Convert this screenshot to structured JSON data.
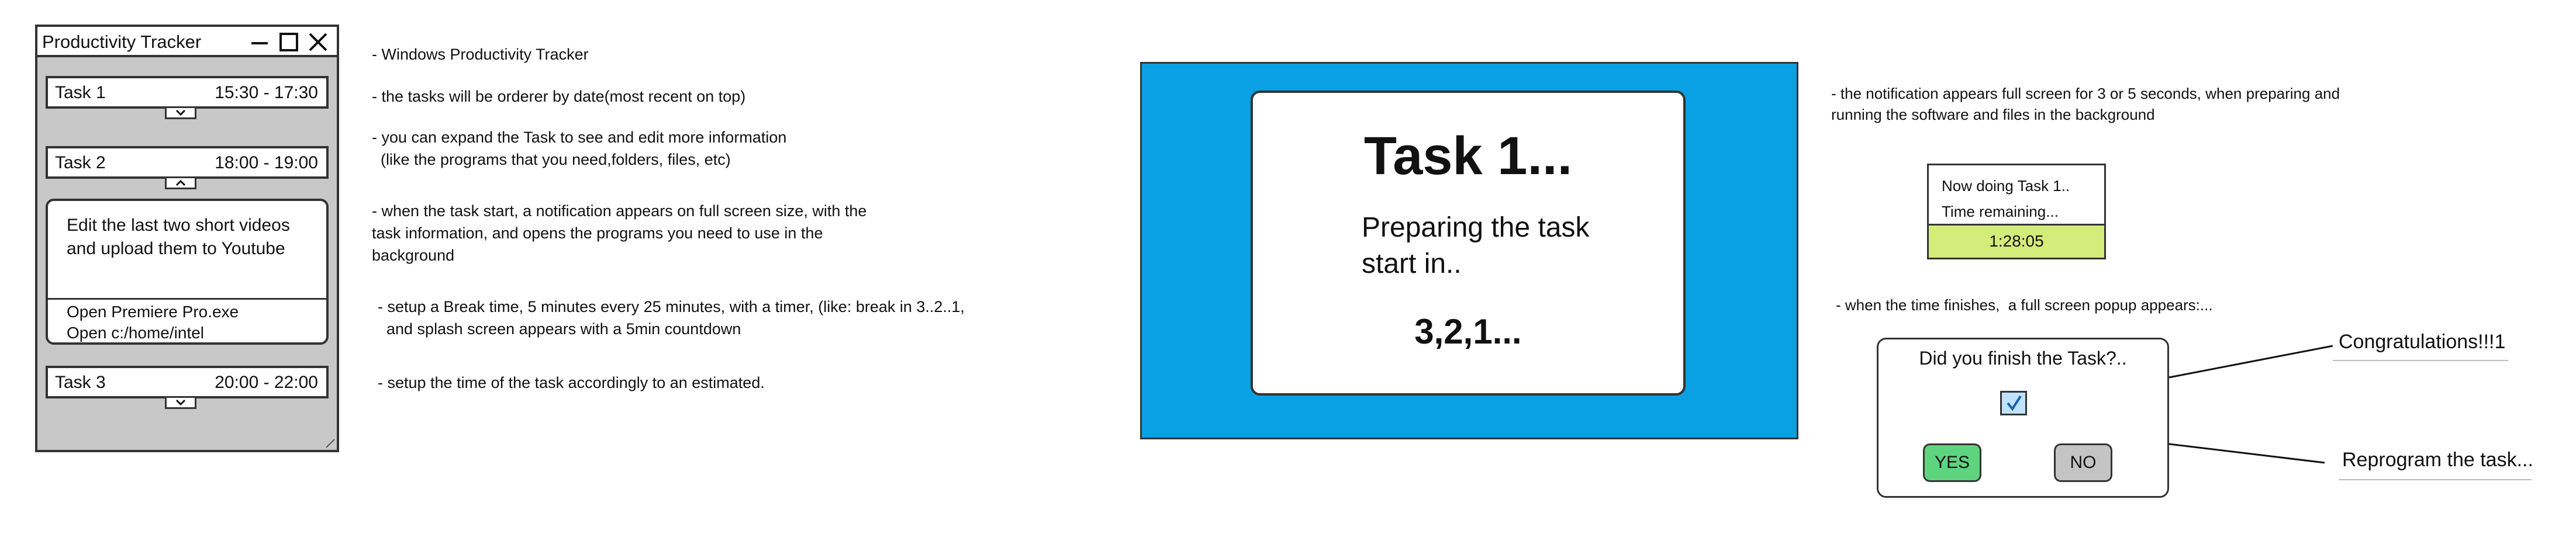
{
  "tracker": {
    "title": "Productivity Tracker",
    "tasks": [
      {
        "name": "Task 1",
        "time": "15:30 - 17:30",
        "expanded": false
      },
      {
        "name": "Task 2",
        "time": "18:00 - 19:00",
        "expanded": true,
        "description": "Edit the last two short videos and upload them to Youtube",
        "programs": [
          "Open Premiere Pro.exe",
          "Open c:/home/intel"
        ]
      },
      {
        "name": "Task 3",
        "time": "20:00 - 22:00",
        "expanded": false
      }
    ]
  },
  "notes": [
    "- Windows Productivity Tracker",
    "- the tasks will be orderer by date(most recent on top)",
    "- you can expand the Task to see and edit more information\n  (like the programs that you need,folders, files, etc)",
    "- when the task start, a notification appears on full screen size, with the\ntask information, and opens the programs you need to use in the\nbackground",
    "- setup a Break time, 5 minutes every 25 minutes, with a timer, (like: break in 3..2..1,\n  and splash screen appears with a 5min countdown",
    "- setup the time of the task accordingly to an estimated."
  ],
  "fullscreen": {
    "title": "Task 1...",
    "preparing": "Preparing the task\nstart in..",
    "countdown": "3,2,1..."
  },
  "right_notes": [
    "- the notification appears full screen for 3 or 5 seconds, when preparing and\nrunning the software and files in the background",
    "- when the time finishes,  a full screen popup appears:..."
  ],
  "mini_notification": {
    "line1": "Now doing Task 1..",
    "line2": "Time remaining...",
    "time": "1:28:05"
  },
  "popup": {
    "question": "Did you finish the Task?..",
    "checked": true,
    "yes": "YES",
    "no": "NO",
    "yes_callout": "Congratulations!!!1",
    "no_callout": "Reprogram the task..."
  },
  "colors": {
    "fullscreen_bg": "#0aa0e4",
    "timer_bg": "#d4ec7a",
    "yes_bg": "#5fd47f",
    "no_bg": "#c4c4c4",
    "window_bg": "#c8c8c8"
  }
}
